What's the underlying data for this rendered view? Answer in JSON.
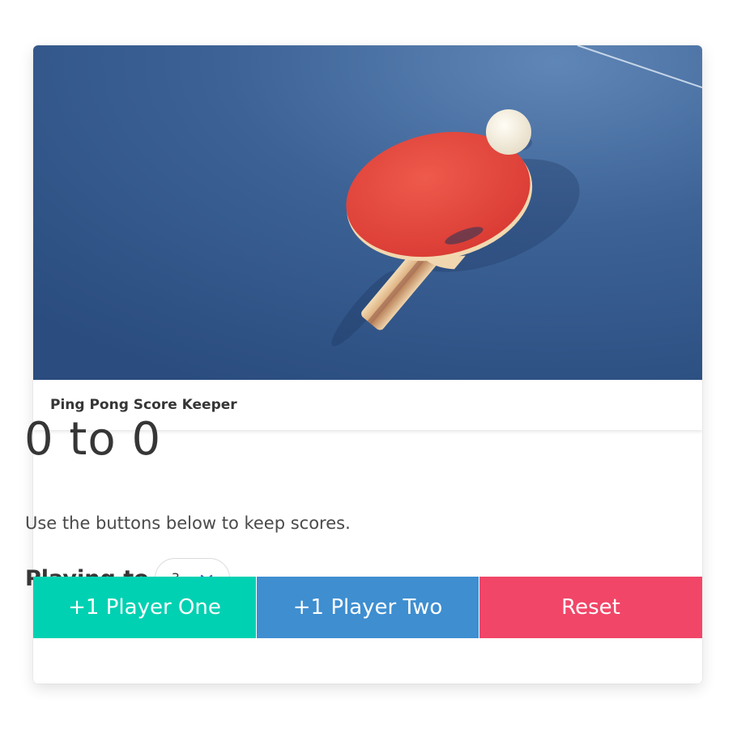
{
  "header": {
    "title": "Ping Pong Score Keeper"
  },
  "score": {
    "player_one": 0,
    "player_two": 0,
    "display": "0 to 0"
  },
  "instructions": "Use the buttons below to keep scores.",
  "playing_to": {
    "label": "Playing to",
    "selected": "3"
  },
  "buttons": {
    "player_one": "+1 Player One",
    "player_two": "+1 Player Two",
    "reset": "Reset"
  },
  "icons": {
    "select_arrow": "chevron-down-icon"
  },
  "colors": {
    "player_one": "#00d1b2",
    "player_two": "#3e8ed0",
    "reset": "#f14668",
    "table": "#2f5386",
    "paddle": "#e5483e"
  }
}
